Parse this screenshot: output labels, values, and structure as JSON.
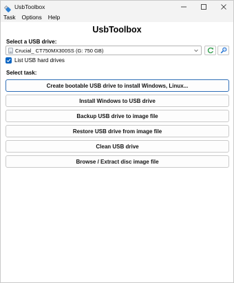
{
  "window": {
    "title": "UsbToolbox"
  },
  "menu": {
    "items": [
      {
        "label": "Task"
      },
      {
        "label": "Options"
      },
      {
        "label": "Help"
      }
    ]
  },
  "main": {
    "heading": "UsbToolbox",
    "select_drive_label": "Select a USB drive:",
    "drive_selected": "Crucial_ CT750MX300SS  (G:  750 GB)",
    "list_hard_drives_label": "List USB hard drives",
    "list_hard_drives_checked": true,
    "select_task_label": "Select task:",
    "tasks": [
      {
        "label": "Create bootable USB drive to install Windows, Linux..."
      },
      {
        "label": "Install Windows to USB drive"
      },
      {
        "label": "Backup USB drive to image file"
      },
      {
        "label": "Restore USB drive from image file"
      },
      {
        "label": "Clean USB drive"
      },
      {
        "label": "Browse / Extract disc image file"
      }
    ]
  },
  "icons": {
    "refresh": "refresh-icon",
    "search": "search-icon",
    "drive": "drive-icon"
  },
  "colors": {
    "accent": "#0a64c2",
    "refresh_green": "#2e9d4a",
    "search_blue": "#1f6fd1",
    "primary_border": "#2f6fb7"
  }
}
